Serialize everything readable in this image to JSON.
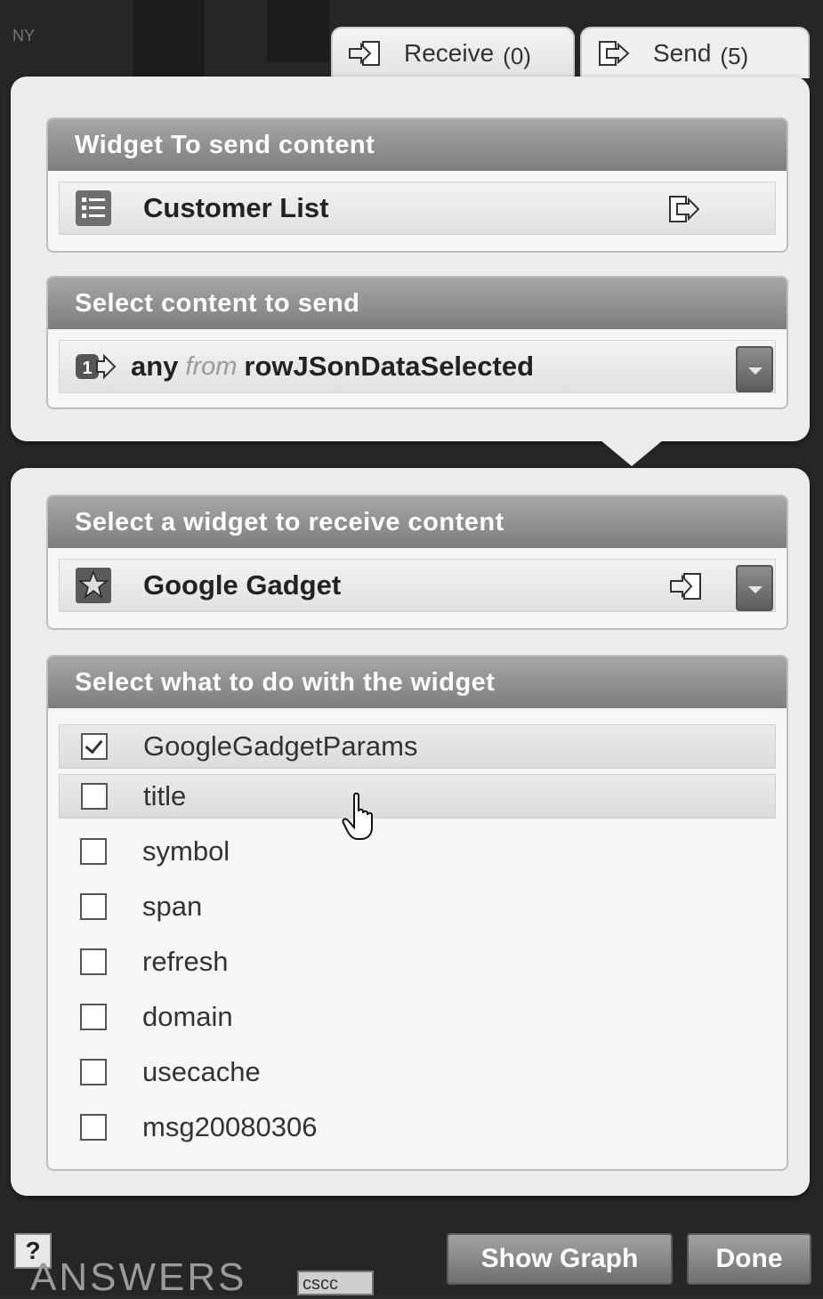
{
  "background": {
    "corner_text": "NY",
    "answers_logo": "ANSWERS",
    "search_value": "cscc",
    "help_label": "?"
  },
  "tabs": [
    {
      "label": "Receive",
      "count": "(0)",
      "icon": "receive-arrow-icon"
    },
    {
      "label": "Send",
      "count": "(5)",
      "icon": "send-arrow-icon"
    }
  ],
  "send_panel": {
    "widget_section": {
      "heading": "Widget To send content",
      "widget_name": "Customer List",
      "widget_icon": "list-icon"
    },
    "content_section": {
      "heading": "Select content to send",
      "value_any": "any",
      "value_from": "from",
      "value_source": "rowJSonDataSelected",
      "icon": "one-arrow-icon"
    }
  },
  "receive_panel": {
    "widget_section": {
      "heading": "Select a widget to receive content",
      "widget_name": "Google Gadget",
      "widget_icon": "gadget-star-icon"
    },
    "action_section": {
      "heading": "Select what to do with the widget",
      "options": [
        {
          "label": "GoogleGadgetParams",
          "checked": true
        },
        {
          "label": "title",
          "checked": false
        },
        {
          "label": "symbol",
          "checked": false
        },
        {
          "label": "span",
          "checked": false
        },
        {
          "label": "refresh",
          "checked": false
        },
        {
          "label": "domain",
          "checked": false
        },
        {
          "label": "usecache",
          "checked": false
        },
        {
          "label": "msg20080306",
          "checked": false
        }
      ]
    }
  },
  "footer": {
    "show_graph_label": "Show Graph",
    "done_label": "Done"
  },
  "colors": {
    "panel_bg": "#ececec",
    "section_header": "#8a8a8a",
    "app_background": "#262626"
  }
}
